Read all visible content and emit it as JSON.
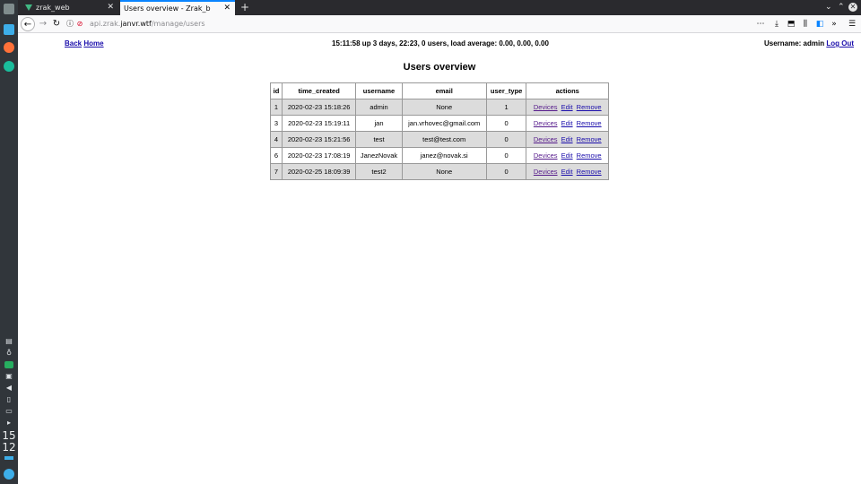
{
  "browser": {
    "tabs": [
      {
        "title": "zrak_web"
      },
      {
        "title": "Users overview - Zrak_b"
      }
    ],
    "url": {
      "prefix": "api.zrak.",
      "domain": "janvr.wtf",
      "path": "/manage/users"
    }
  },
  "taskbar": {
    "clock_hour": "15",
    "clock_minute": "12"
  },
  "page": {
    "back_label": "Back",
    "home_label": "Home",
    "status": "15:11:58 up 3 days, 22:23, 0 users, load average: 0.00, 0.00, 0.00",
    "username_label": "Username: admin",
    "logout_label": "Log Out",
    "title": "Users overview"
  },
  "table": {
    "headers": [
      "id",
      "time_created",
      "username",
      "email",
      "user_type",
      "actions"
    ],
    "action_labels": {
      "devices": "Devices",
      "edit": "Edit",
      "remove": "Remove"
    },
    "rows": [
      {
        "id": "1",
        "time_created": "2020-02-23 15:18:26",
        "username": "admin",
        "email": "None",
        "user_type": "1"
      },
      {
        "id": "3",
        "time_created": "2020-02-23 15:19:11",
        "username": "jan",
        "email": "jan.vrhovec@gmail.com",
        "user_type": "0"
      },
      {
        "id": "4",
        "time_created": "2020-02-23 15:21:56",
        "username": "test",
        "email": "test@test.com",
        "user_type": "0"
      },
      {
        "id": "6",
        "time_created": "2020-02-23 17:08:19",
        "username": "JanezNovak",
        "email": "janez@novak.si",
        "user_type": "0"
      },
      {
        "id": "7",
        "time_created": "2020-02-25 18:09:39",
        "username": "test2",
        "email": "None",
        "user_type": "0"
      }
    ]
  }
}
